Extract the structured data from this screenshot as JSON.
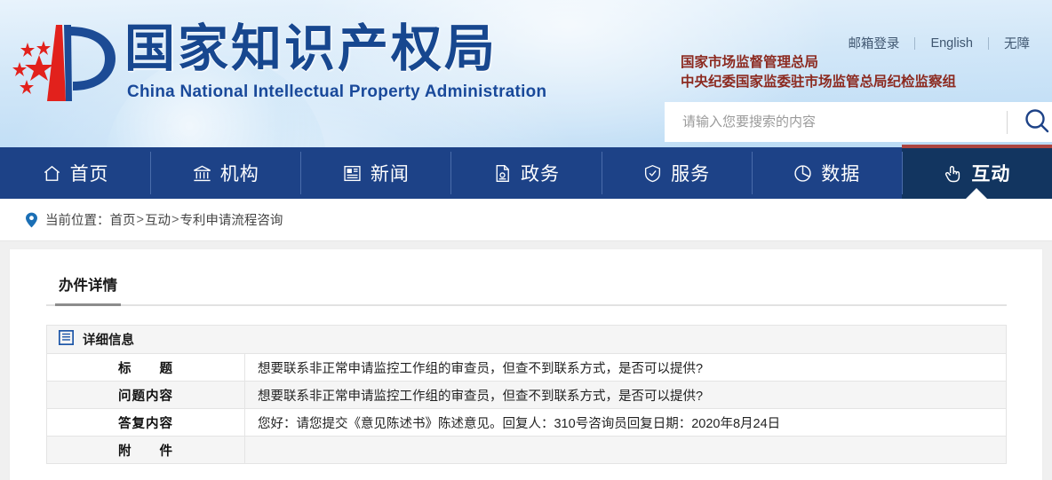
{
  "header": {
    "logo_cn": "国家知识产权局",
    "logo_en": "China National Intellectual Property Administration",
    "logo_icon": "cnipa-emblem-icon",
    "top_links": [
      {
        "label": "邮箱登录",
        "name": "mail-login-link"
      },
      {
        "label": "English",
        "name": "english-link"
      },
      {
        "label": "无障",
        "name": "accessibility-link"
      }
    ],
    "agency_line_1": "国家市场监督管理总局",
    "agency_line_2": "中央纪委国家监委驻市场监管总局纪检监察组",
    "agency_color": "#8c2a20",
    "search": {
      "placeholder": "请输入您要搜索的内容",
      "value": "",
      "icon": "search-icon"
    }
  },
  "nav": {
    "active_index": 6,
    "bar_color": "#1d4287",
    "active_color": "#123560",
    "accent_color": "#ad4540",
    "items": [
      {
        "label": "首页",
        "icon": "home-icon"
      },
      {
        "label": "机构",
        "icon": "bank-icon"
      },
      {
        "label": "新闻",
        "icon": "newspaper-icon"
      },
      {
        "label": "政务",
        "icon": "document-icon"
      },
      {
        "label": "服务",
        "icon": "shield-check-icon"
      },
      {
        "label": "数据",
        "icon": "pie-chart-icon"
      },
      {
        "label": "互动",
        "icon": "click-hand-icon"
      }
    ]
  },
  "breadcrumb": {
    "icon": "location-pin-icon",
    "prefix": "当前位置：",
    "items": [
      "首页",
      "互动",
      "专利申请流程咨询"
    ],
    "separator": ">"
  },
  "main": {
    "tab_label": "办件详情",
    "section": {
      "icon": "list-panel-icon",
      "title": "详细信息"
    },
    "rows": [
      {
        "label": "标　　题",
        "value": "想要联系非正常申请监控工作组的审查员，但查不到联系方式，是否可以提供?"
      },
      {
        "label": "问题内容",
        "value": "想要联系非正常申请监控工作组的审查员，但查不到联系方式，是否可以提供?"
      },
      {
        "label": "答复内容",
        "value": "您好：请您提交《意见陈述书》陈述意见。回复人：310号咨询员回复日期：2020年8月24日"
      },
      {
        "label": "附　　件",
        "value": ""
      }
    ]
  }
}
